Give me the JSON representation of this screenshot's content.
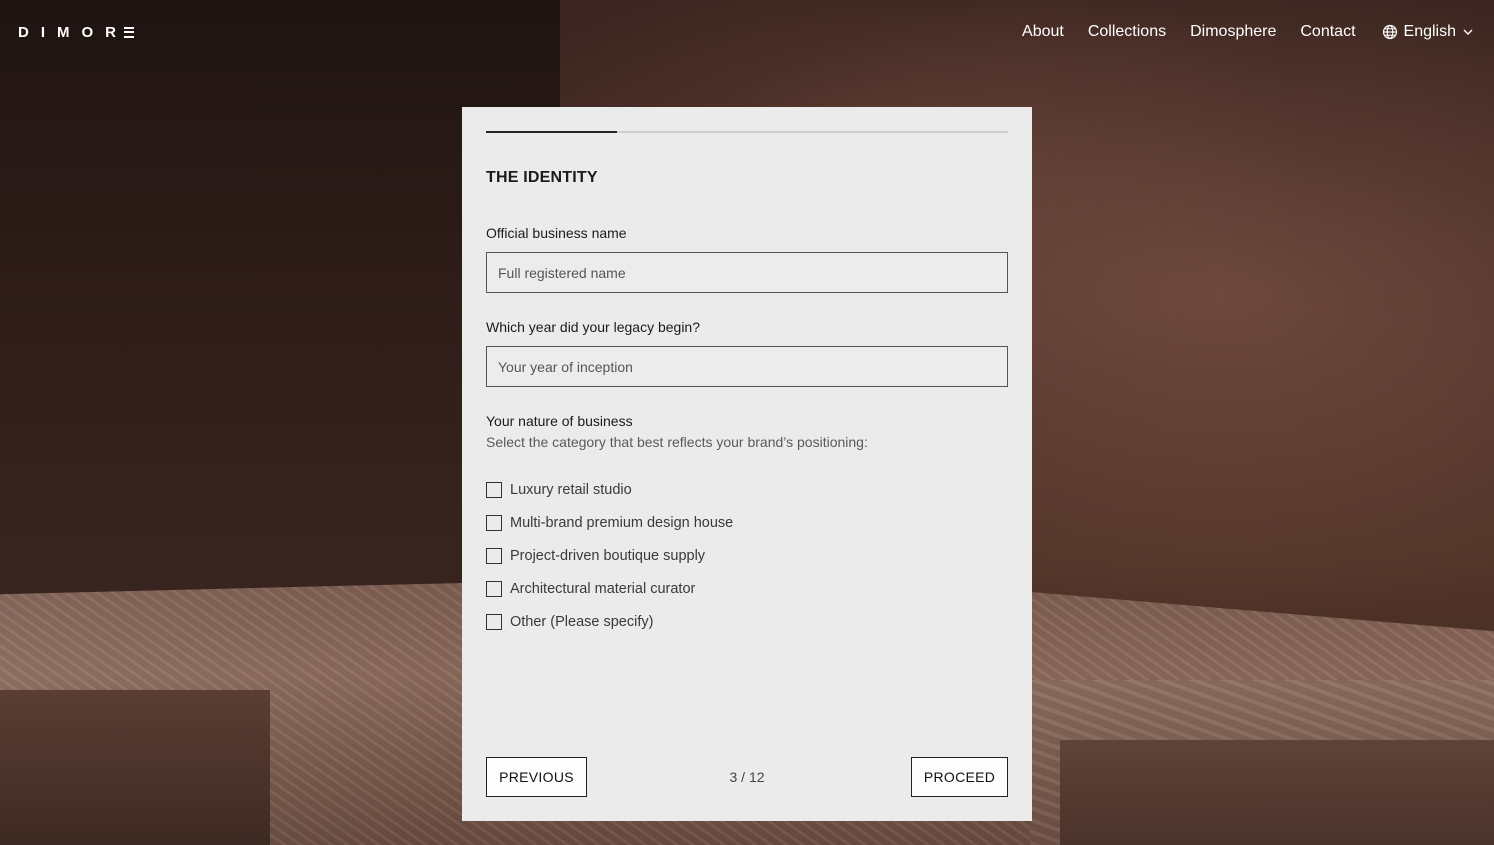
{
  "brand": {
    "logo_text": "DIMOR"
  },
  "nav": {
    "items": [
      {
        "label": "About"
      },
      {
        "label": "Collections"
      },
      {
        "label": "Dimosphere"
      },
      {
        "label": "Contact"
      }
    ],
    "language": "English"
  },
  "form": {
    "progress_fraction": 0.25,
    "section_title": "THE IDENTITY",
    "business_name": {
      "label": "Official business name",
      "placeholder": "Full registered name",
      "value": ""
    },
    "inception_year": {
      "label": "Which year did your legacy begin?",
      "placeholder": "Your year of inception",
      "value": ""
    },
    "nature": {
      "label": "Your nature of business",
      "helper": "Select the category that best reflects your brand’s positioning:",
      "options": [
        {
          "label": "Luxury retail studio",
          "checked": false
        },
        {
          "label": "Multi-brand premium design house",
          "checked": false
        },
        {
          "label": "Project-driven boutique supply",
          "checked": false
        },
        {
          "label": "Architectural material curator",
          "checked": false
        },
        {
          "label": "Other (Please specify)",
          "checked": false
        }
      ]
    },
    "previous_label": "PREVIOUS",
    "proceed_label": "PROCEED",
    "step": "3 / 12"
  },
  "colors": {
    "card_bg": "#ebebeb",
    "text_dark": "#1b1b1b",
    "progress_fill": "#2a2522",
    "progress_track": "#cfcfcf"
  }
}
